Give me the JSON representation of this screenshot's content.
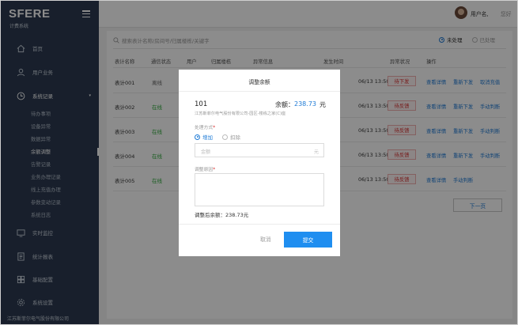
{
  "sidebar": {
    "logo": "SFERE",
    "subtitle": "计费系统",
    "nav": [
      {
        "label": "首页",
        "icon": "home-icon"
      },
      {
        "label": "用户业务",
        "icon": "user-icon"
      },
      {
        "label": "系统记录",
        "icon": "clock-icon",
        "active": true
      },
      {
        "label": "实时监控",
        "icon": "monitor-icon"
      },
      {
        "label": "统计报表",
        "icon": "report-icon"
      },
      {
        "label": "基础配置",
        "icon": "config-icon"
      },
      {
        "label": "系统设置",
        "icon": "settings-icon"
      }
    ],
    "sub_items": [
      "待办事项",
      "设备异常",
      "数据异常",
      "余额调整",
      "告警记录",
      "业务办理记录",
      "线上充值办理",
      "参数变动记录",
      "系统日志"
    ],
    "active_sub": 3,
    "footer": "江苏斯菲尔电气股份有限公司"
  },
  "topbar": {
    "username": "用户名,",
    "greeting": "您好"
  },
  "search": {
    "placeholder": "搜索表计名称/房间号/归属楼栋/关键字"
  },
  "filter": {
    "options": [
      "未处理",
      "已处理"
    ],
    "selected": 0
  },
  "table": {
    "headers": [
      "表计名称",
      "通信状态",
      "用户",
      "归属楼栋",
      "异常信息",
      "发生时间",
      "异常状况",
      "操作"
    ],
    "rows": [
      {
        "name": "表计001",
        "comm": "离线",
        "time": "06/13 13:50:34",
        "status": "待下发",
        "ops": [
          "查看详情",
          "重新下发",
          "取消充值"
        ]
      },
      {
        "name": "表计002",
        "comm": "在线",
        "time": "06/13 13:50:34",
        "status": "待反馈",
        "ops": [
          "查看详情",
          "重新下发",
          "手动判断"
        ]
      },
      {
        "name": "表计003",
        "comm": "在线",
        "time": "06/13 13:50:34",
        "status": "待反馈",
        "ops": [
          "查看详情",
          "重新下发",
          "手动判断"
        ]
      },
      {
        "name": "表计004",
        "comm": "在线",
        "time": "06/13 13:50:34",
        "status": "待反馈",
        "ops": [
          "查看详情",
          "重新下发",
          "手动判断"
        ]
      },
      {
        "name": "表计005",
        "comm": "在线",
        "time": "06/13 13:50:34",
        "status": "待反馈",
        "ops": [
          "查看详情",
          "手动判断"
        ]
      }
    ],
    "next_label": "下一页"
  },
  "modal": {
    "title": "调整余额",
    "meter_no": "101",
    "balance_label": "余额：",
    "balance_value": "238.73",
    "balance_unit": "元",
    "meter_desc": "江苏斯菲尔电气股份有限公司-园区-楼栋之家(C)座",
    "method_label": "处理方式",
    "method_options": [
      "增加",
      "扣除"
    ],
    "method_selected": 0,
    "amount_placeholder": "金额",
    "amount_unit": "元",
    "reason_label": "调整原因",
    "after_label": "调整后余额：",
    "after_value": "238.73元",
    "cancel_label": "取消",
    "submit_label": "提交"
  }
}
